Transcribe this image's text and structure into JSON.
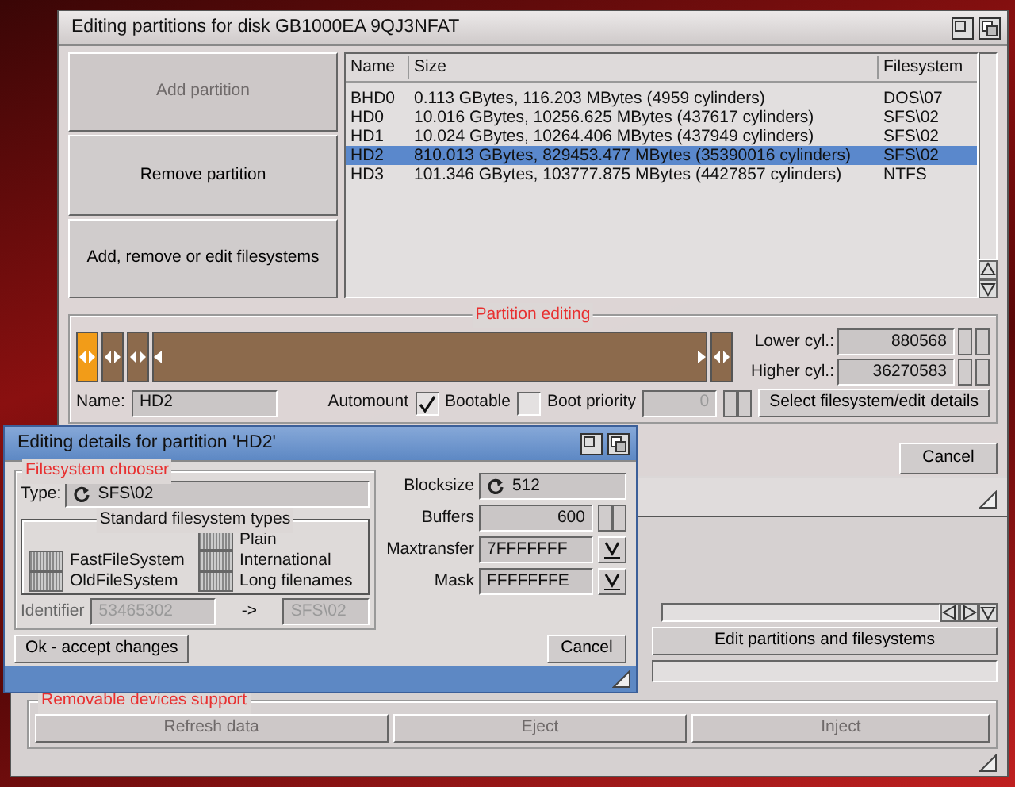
{
  "main_window": {
    "title": "Editing partitions for disk GB1000EA 9QJ3NFAT",
    "side_buttons": [
      {
        "label": "Add partition",
        "disabled": true
      },
      {
        "label": "Remove partition",
        "disabled": false
      },
      {
        "label": "Add, remove or edit filesystems",
        "disabled": false
      }
    ],
    "partitions": {
      "columns": [
        "Name",
        "Size",
        "Filesystem"
      ],
      "rows": [
        {
          "name": "BHD0",
          "size": "0.113 GBytes, 116.203 MBytes (4959 cylinders)",
          "filesystem": "DOS\\07",
          "selected": false
        },
        {
          "name": "HD0",
          "size": "10.016 GBytes, 10256.625 MBytes (437617 cylinders)",
          "filesystem": "SFS\\02",
          "selected": false
        },
        {
          "name": "HD1",
          "size": "10.024 GBytes, 10264.406 MBytes (437949 cylinders)",
          "filesystem": "SFS\\02",
          "selected": false
        },
        {
          "name": "HD2",
          "size": "810.013 GBytes, 829453.477 MBytes (35390016 cylinders)",
          "filesystem": "SFS\\02",
          "selected": true
        },
        {
          "name": "HD3",
          "size": "101.346 GBytes, 103777.875 MBytes (4427857 cylinders)",
          "filesystem": "NTFS",
          "selected": false
        }
      ]
    },
    "editing": {
      "title": "Partition editing",
      "segments": [
        {
          "kind": "marker",
          "selected": true
        },
        {
          "kind": "marker",
          "selected": false
        },
        {
          "kind": "marker",
          "selected": false
        },
        {
          "kind": "span",
          "selected": false
        },
        {
          "kind": "marker",
          "selected": false
        }
      ],
      "lower_label": "Lower cyl.:",
      "lower": "880568",
      "higher_label": "Higher cyl.:",
      "higher": "36270583",
      "name_label": "Name:",
      "name": "HD2",
      "automount": {
        "label": "Automount",
        "checked": true
      },
      "bootable": {
        "label": "Bootable",
        "checked": false
      },
      "boot_priority": {
        "label": "Boot priority",
        "value": "0",
        "disabled": true
      },
      "select_button": "Select filesystem/edit details"
    },
    "cancel": "Cancel"
  },
  "details_dialog": {
    "title": "Editing details for partition 'HD2'",
    "chooser": {
      "title": "Filesystem chooser",
      "type_label": "Type:",
      "type": "SFS\\02",
      "standard_title": "Standard filesystem types",
      "standard_types": [
        "FastFileSystem",
        "OldFileSystem",
        "Plain",
        "International",
        "Long filenames"
      ],
      "identifier_label": "Identifier",
      "identifier": "53465302",
      "arrow": "->",
      "identifier_name": "SFS\\02"
    },
    "blocksize_label": "Blocksize",
    "blocksize": "512",
    "buffers_label": "Buffers",
    "buffers": "600",
    "maxtransfer_label": "Maxtransfer",
    "maxtransfer": "7FFFFFFF",
    "mask_label": "Mask",
    "mask": "FFFFFFFE",
    "ok": "Ok - accept changes",
    "cancel": "Cancel"
  },
  "back_window": {
    "edit_button": "Edit partitions and filesystems",
    "removable": {
      "title": "Removable devices support",
      "buttons": [
        {
          "label": "Refresh data",
          "disabled": true
        },
        {
          "label": "Eject",
          "disabled": true
        },
        {
          "label": "Inject",
          "disabled": true
        }
      ]
    }
  }
}
